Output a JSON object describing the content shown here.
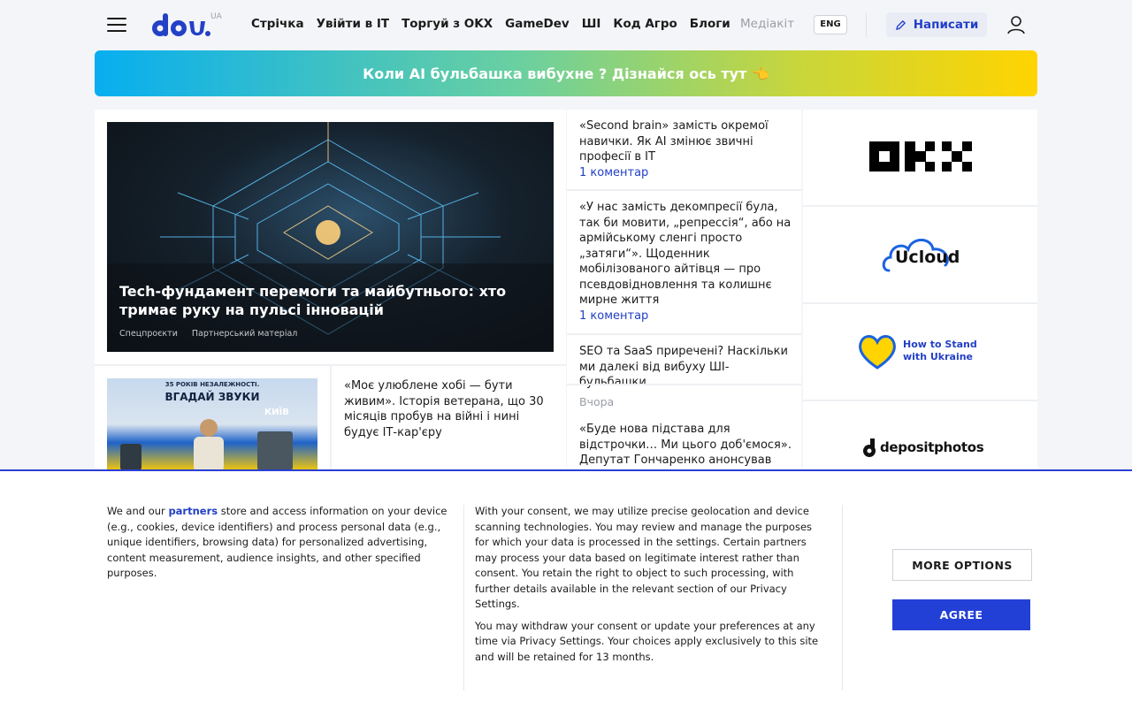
{
  "header": {
    "logo_text": "dou",
    "logo_suffix": "UA",
    "nav": [
      "Стрічка",
      "Увійти в IT",
      "Торгуй з OKX",
      "GameDev",
      "ШІ",
      "Код Агро",
      "Блоги"
    ],
    "media": "Медіакіт",
    "lang": "ENG",
    "write_label": "Написати"
  },
  "banner": {
    "text": "Коли AI бульбашка вибухне ? Дізнайся ось тут 👈"
  },
  "main": {
    "hero": {
      "title": "Tech-фундамент перемоги та майбутнього: хто тримає руку на пульсі інновацій",
      "tags": [
        "Спецпроєкти",
        "Партнерський матеріал"
      ]
    },
    "second": {
      "thumb_line1": "35 РОКІВ НЕЗАЛЕЖНОСТІ.",
      "thumb_line2": "ВГАДАЙ ЗВУКИ",
      "thumb_city": "КИЇВ",
      "title": "«Моє улюблене хобі — бути живим». Історія ветерана, що 30 місяців пробув на війні і нині будує ІТ-кар'єру"
    }
  },
  "middle": {
    "items": [
      {
        "title": "«Second brain» замість окремої навички. Як AI змінює звичні професії в IT",
        "comments": "1 коментар"
      },
      {
        "title": "«У нас замість декомпресії була, так би мовити, „репрессія“, або на армійському сленгі просто „затяги“». Щоденник мобілізованого айтівця — про псевдовідновлення та колишнє мирне життя",
        "comments": "1 коментар"
      },
      {
        "title": "SEO та SaaS приречені? Наскільки ми далекі від вибуху ШІ-бульбашки",
        "comments": ""
      }
    ],
    "date_label": "Вчора",
    "next_title": "«Буде нова підстава для відстрочки… Ми цього доб'ємося». Депутат Гончаренко анонсував"
  },
  "partners": {
    "ucloud": "Ucloud",
    "stand_line1": "How to Stand",
    "stand_line2": "with Ukraine",
    "deposit": "depositphotos"
  },
  "consent": {
    "col1_prefix": "We and our ",
    "col1_link": "partners",
    "col1_rest": " store and access information on your device (e.g., cookies, device identifiers) and process personal data (e.g., unique identifiers, browsing data) for personalized advertising, content measurement, audience insights, and other specified purposes.",
    "col2_p1": "With your consent, we may utilize precise geolocation and device scanning technologies. You may review and manage the purposes for which your data is processed in the settings. Certain partners may process your data based on legitimate interest rather than consent. You retain the right to object to such processing, with further details available in the relevant section of our Privacy Settings.",
    "col2_p2": "You may withdraw your consent or update your preferences at any time via Privacy Settings. Your choices apply exclusively to this site and will be retained for 13 months.",
    "more_options": "MORE OPTIONS",
    "agree": "AGREE"
  },
  "colors": {
    "accent": "#2340c7",
    "agree_bg": "#2340d6"
  }
}
